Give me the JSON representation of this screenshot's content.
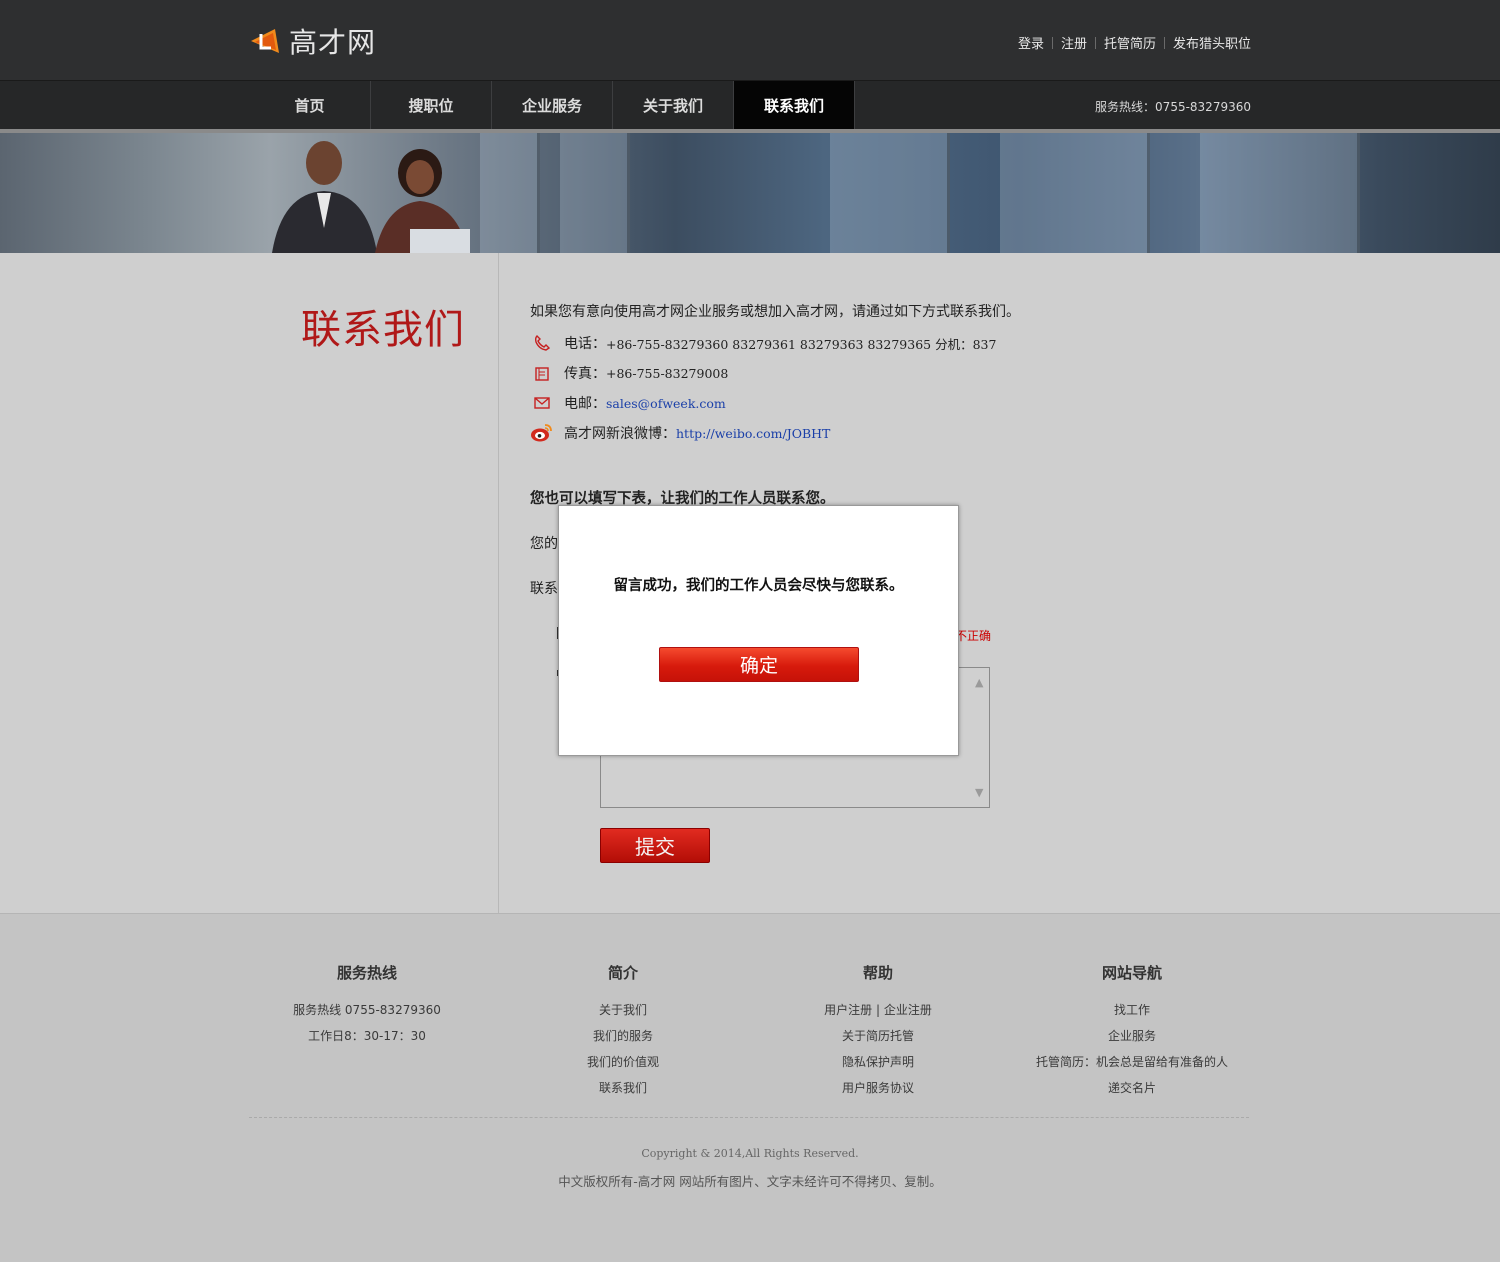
{
  "header": {
    "logo_text": "高才网",
    "top_links": [
      "登录",
      "注册",
      "托管简历",
      "发布猎头职位"
    ]
  },
  "nav": {
    "items": [
      "首页",
      "搜职位",
      "企业服务",
      "关于我们",
      "联系我们"
    ],
    "active_index": 4,
    "hotline": "服务热线：0755-83279360"
  },
  "page": {
    "title": "联系我们",
    "intro": "如果您有意向使用高才网企业服务或想加入高才网，请通过如下方式联系我们。",
    "phone_label": "电话：",
    "phone_value": "+86-755-83279360 83279361 83279363 83279365 分机：837",
    "fax_label": "传真：",
    "fax_value": "+86-755-83279008",
    "email_label": "电邮：",
    "email_value": "sales@ofweek.com",
    "weibo_label": "高才网新浪微博：",
    "weibo_value": "http://weibo.com/JOBHT",
    "form_heading": "您也可以填写下表，让我们的工作人员联系您。",
    "form_label_1": "您的",
    "form_label_2": "联系",
    "error_text": "不正确",
    "submit_label": "提交"
  },
  "footer": {
    "columns": [
      {
        "title": "服务热线",
        "lines": [
          "服务热线 0755-83279360",
          "工作日8：30-17：30"
        ]
      },
      {
        "title": "简介",
        "lines": [
          "关于我们",
          "我们的服务",
          "我们的价值观",
          "联系我们"
        ]
      },
      {
        "title": "帮助",
        "lines": [
          "用户注册 | 企业注册",
          "关于简历托管",
          "隐私保护声明",
          "用户服务协议"
        ]
      },
      {
        "title": "网站导航",
        "lines": [
          "找工作",
          "企业服务",
          "托管简历：机会总是留给有准备的人",
          "递交名片"
        ]
      }
    ],
    "copyright": "Copyright & 2014,All Rights Reserved.",
    "rights": "中文版权所有-高才网 网站所有图片、文字未经许可不得拷贝、复制。"
  },
  "modal": {
    "message": "留言成功，我们的工作人员会尽快与您联系。",
    "confirm_label": "确定"
  },
  "colors": {
    "brand_red": "#b01818",
    "button_red": "#d71a0c",
    "header_bg": "#2e2f30",
    "link_blue": "#1a3fa8"
  }
}
